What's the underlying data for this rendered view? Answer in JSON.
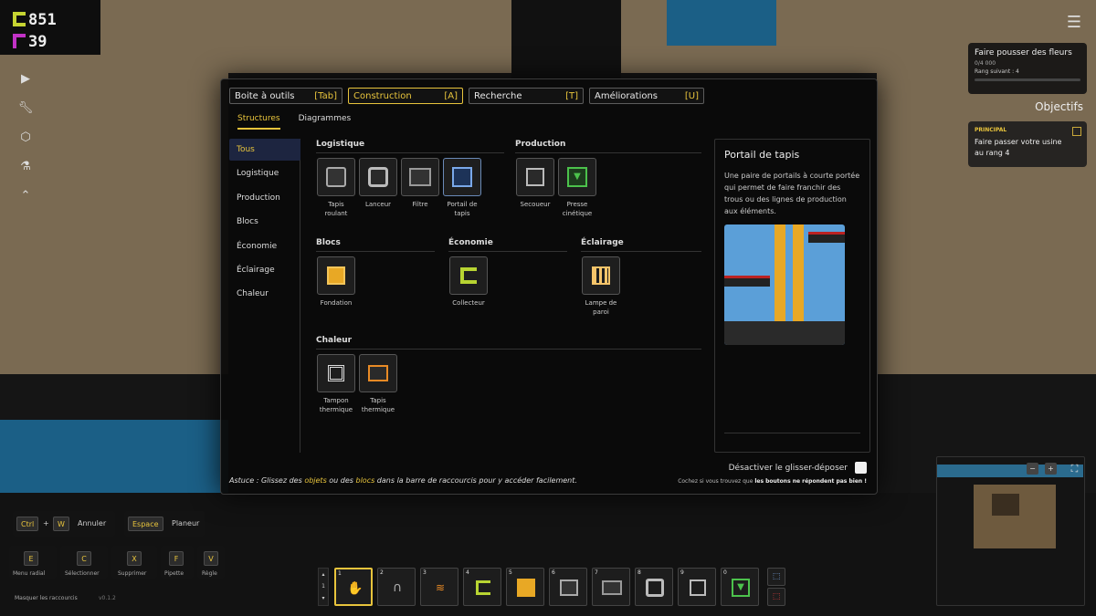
{
  "resources": {
    "copper": "851",
    "crystal": "39"
  },
  "left_tools": [
    "play-icon",
    "wrench-icon",
    "cube-icon",
    "flask-icon",
    "chevrons-up-icon"
  ],
  "goal": {
    "title": "Faire pousser des fleurs",
    "progress": "0/4 000",
    "next": "Rang suivant : 4"
  },
  "objectives": {
    "title": "Objectifs",
    "tag": "PRINCIPAL",
    "text": "Faire passer votre usine au rang 4"
  },
  "tabs": [
    {
      "label": "Boite à outils",
      "key": "[Tab]"
    },
    {
      "label": "Construction",
      "key": "[A]"
    },
    {
      "label": "Recherche",
      "key": "[T]"
    },
    {
      "label": "Améliorations",
      "key": "[U]"
    }
  ],
  "subtabs": [
    "Structures",
    "Diagrammes"
  ],
  "categories": [
    "Tous",
    "Logistique",
    "Production",
    "Blocs",
    "Économie",
    "Éclairage",
    "Chaleur"
  ],
  "sections": {
    "logistique": {
      "title": "Logistique",
      "items": [
        "Tapis roulant",
        "Lanceur",
        "Filtre",
        "Portail de tapis"
      ]
    },
    "production": {
      "title": "Production",
      "items": [
        "Secoueur",
        "Presse cinétique"
      ]
    },
    "blocs": {
      "title": "Blocs",
      "items": [
        "Fondation"
      ]
    },
    "economie": {
      "title": "Économie",
      "items": [
        "Collecteur"
      ]
    },
    "eclairage": {
      "title": "Éclairage",
      "items": [
        "Lampe de paroi"
      ]
    },
    "chaleur": {
      "title": "Chaleur",
      "items": [
        "Tampon thermique",
        "Tapis thermique"
      ]
    }
  },
  "detail": {
    "title": "Portail de tapis",
    "description": "Une paire de portails à courte portée qui permet de faire franchir des trous ou des lignes de production aux éléments."
  },
  "hint": {
    "prefix": "Astuce : Glissez des ",
    "objects": "objets",
    "middle": " ou des ",
    "blocks": "blocs",
    "suffix": " dans la barre de raccourcis pour y accéder facilement."
  },
  "drag": {
    "label": "Désactiver le glisser-déposer",
    "note_prefix": "Cochez si vous trouvez que ",
    "note_bold": "les boutons ne répondent pas bien !"
  },
  "shortcuts": {
    "ctrl": "Ctrl",
    "plus": "+",
    "w": "W",
    "undo": "Annuler",
    "space": "Espace",
    "planner": "Planeur",
    "keys": [
      {
        "key": "E",
        "label": "Menu radial"
      },
      {
        "key": "C",
        "label": "Sélectionner"
      },
      {
        "key": "X",
        "label": "Supprimer"
      },
      {
        "key": "F",
        "label": "Pipette"
      },
      {
        "key": "V",
        "label": "Règle"
      }
    ],
    "hide": "Masquer les raccourcis",
    "version": "v0.1.2"
  },
  "hotbar": {
    "page": "1",
    "slots": [
      "1",
      "2",
      "3",
      "4",
      "5",
      "6",
      "7",
      "8",
      "9",
      "0"
    ]
  },
  "minimap": {
    "minus": "−",
    "plus": "+"
  },
  "colors": {
    "accent": "#e8c43c",
    "panel": "#0a0a0a",
    "copper": "#c6d432",
    "crystal": "#c232c6"
  }
}
